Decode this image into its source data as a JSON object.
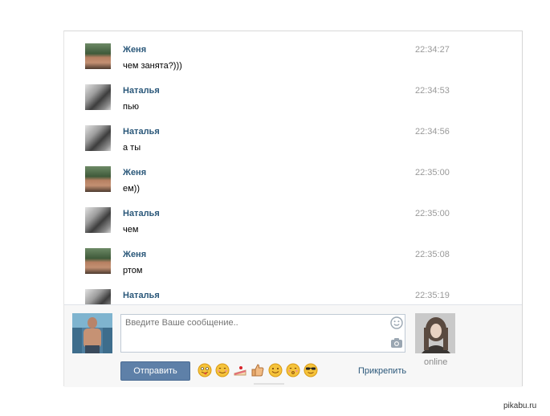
{
  "messages": [
    {
      "author": "Женя",
      "text": "чем занята?)))",
      "time": "22:34:27",
      "avatar": "zhenya"
    },
    {
      "author": "Наталья",
      "text": "пью",
      "time": "22:34:53",
      "avatar": "natalya"
    },
    {
      "author": "Наталья",
      "text": "а ты",
      "time": "22:34:56",
      "avatar": "natalya"
    },
    {
      "author": "Женя",
      "text": "ем))",
      "time": "22:35:00",
      "avatar": "zhenya"
    },
    {
      "author": "Наталья",
      "text": "чем",
      "time": "22:35:00",
      "avatar": "natalya"
    },
    {
      "author": "Женя",
      "text": "ртом",
      "time": "22:35:08",
      "avatar": "zhenya"
    },
    {
      "author": "Наталья",
      "text": "",
      "time": "22:35:19",
      "avatar": "natalya"
    }
  ],
  "composer": {
    "placeholder": "Введите Ваше сообщение..",
    "send_label": "Отправить",
    "attach_label": "Прикрепить",
    "status": "online",
    "emojis": [
      "winking-tongue-face",
      "smiling-face",
      "cake-slice",
      "thumbs-up",
      "smiling-face",
      "kissing-face",
      "sunglasses-face"
    ]
  },
  "watermark": "pikabu.ru",
  "colors": {
    "author": "#2b587a",
    "time": "#999999",
    "send_button": "#5e80a8",
    "online": "#8a8a8a"
  }
}
